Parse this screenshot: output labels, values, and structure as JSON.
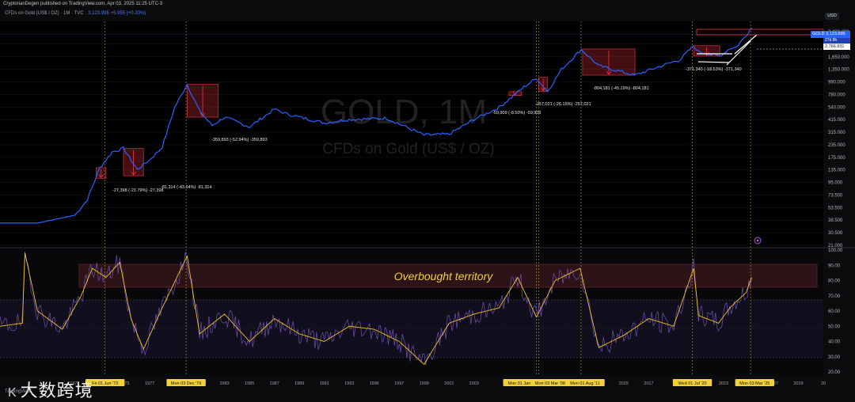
{
  "header": {
    "publisher_line": "CryptorianDegen published on TradingView.com, Apr 03, 2025 11:25 UTC-3",
    "legend_name": "CFDs on Gold (US$ / OZ) · 1M · TVC",
    "legend_values": "3,123.995 +5.955 (+0.20%)"
  },
  "watermark": {
    "symbol": "GOLD, 1M",
    "description": "CFDs on Gold (US$ / OZ)"
  },
  "price_axis": {
    "currency": "USD",
    "labels": [
      "3,430.000",
      "2,790.000",
      "1,650.000",
      "1,350.000",
      "990.000",
      "780.000",
      "540.000",
      "415.000",
      "315.000",
      "235.000",
      "175.000",
      "135.000",
      "95.000",
      "73.500",
      "53.500",
      "38.500",
      "30.500",
      "21.000"
    ]
  },
  "price_badge": {
    "symbol": "GOLD",
    "value": "3,123.995",
    "countdown": "27d 8h",
    "level": "2,766.931"
  },
  "rsi_axis": {
    "labels": [
      "100.00",
      "90.00",
      "80.00",
      "70.00",
      "60.00",
      "50.00",
      "40.00",
      "30.00",
      "20.00"
    ]
  },
  "time_axis": {
    "labels": [
      "1971",
      "1975",
      "1977",
      "1983",
      "1985",
      "1987",
      "1989",
      "1991",
      "1993",
      "1995",
      "1997",
      "1999",
      "2001",
      "2003",
      "2013",
      "2015",
      "2017",
      "2023",
      "2027",
      "2029",
      "20"
    ],
    "highlighted": [
      "Fri 01 Jun '73",
      "Mon 03 Dec '79",
      "Mon 01 Jan '08",
      "Mon 03 Mar '08",
      "Mon 01 Aug '11",
      "Wed 01 Jul '20",
      "Mon 03 Mar '25"
    ]
  },
  "annotations": {
    "a1": "-27,398 (-21.79%) -27,398",
    "a2": "-81,314 (-43.64%) -81,314",
    "a3": "-359,893 (-52.94%) -359,893",
    "a4": "-59,909 (-8.50%) -59,909",
    "a5": "-257,021 (-26.15%) -257,021",
    "a6": "-804,181 (-45.19%) -804,181",
    "a7": "-371,340 (-18.53%) -371,340"
  },
  "rsi_overlay": {
    "label": "Overbought territory"
  },
  "footer": {
    "tv_logo": "TradingView",
    "brand_mark": "K",
    "brand_name": "大数跨境"
  },
  "colors": {
    "price_line": "#2962ff",
    "rsi_line": "#7e57c2",
    "rsi_ma": "#f0c419",
    "drawdown": "#f23645",
    "highlight": "#f2d13a"
  },
  "chart_data": [
    {
      "type": "line",
      "title": "GOLD, 1M",
      "subtitle": "CFDs on Gold (US$ / OZ)",
      "scale": "log",
      "ylim": [
        21,
        3430
      ],
      "x": [
        1965,
        1968,
        1971,
        1972,
        1973,
        1974,
        1974.9,
        1976,
        1977,
        1978,
        1979,
        1980,
        1981,
        1982,
        1983,
        1985,
        1987,
        1988,
        1991,
        1993,
        1996,
        1999,
        2001,
        2003,
        2005,
        2007,
        2008,
        2008.9,
        2010,
        2011.6,
        2013,
        2015.9,
        2018,
        2019.5,
        2020.6,
        2021,
        2022.7,
        2023.5,
        2024,
        2024.5,
        2025.25
      ],
      "values": [
        35,
        35,
        42,
        60,
        125,
        180,
        195,
        120,
        150,
        200,
        500,
        850,
        460,
        330,
        400,
        320,
        480,
        430,
        350,
        380,
        390,
        265,
        270,
        380,
        500,
        800,
        980,
        720,
        1200,
        1900,
        1300,
        1050,
        1300,
        1500,
        2060,
        1800,
        1630,
        1950,
        2000,
        2350,
        3124
      ],
      "series": [
        {
          "name": "GOLD",
          "color": "#2962ff"
        }
      ]
    },
    {
      "type": "line",
      "ylim": [
        20,
        100
      ],
      "x": [
        1965,
        1966.8,
        1967,
        1968,
        1970,
        1971.5,
        1972.4,
        1973.5,
        1974.6,
        1975.5,
        1976.5,
        1978,
        1980,
        1981,
        1983,
        1985,
        1987,
        1989,
        1991,
        1993,
        1995,
        1997,
        1999,
        2001,
        2003,
        2005,
        2006.5,
        2008,
        2009.5,
        2011.5,
        2013,
        2015,
        2017,
        2019,
        2020.6,
        2021,
        2022.6,
        2023.5,
        2024,
        2024.8,
        2025.25
      ],
      "values": [
        50,
        52,
        98,
        60,
        48,
        70,
        88,
        82,
        92,
        55,
        35,
        62,
        96,
        45,
        58,
        40,
        55,
        45,
        40,
        50,
        48,
        40,
        25,
        52,
        58,
        62,
        82,
        56,
        80,
        88,
        36,
        44,
        55,
        50,
        88,
        57,
        52,
        62,
        66,
        72,
        82
      ],
      "series": [
        {
          "name": "RSI",
          "color": "#7e57c2"
        },
        {
          "name": "RSI MA",
          "color": "#f0c419"
        }
      ],
      "annotations": [
        "Overbought territory"
      ]
    }
  ]
}
